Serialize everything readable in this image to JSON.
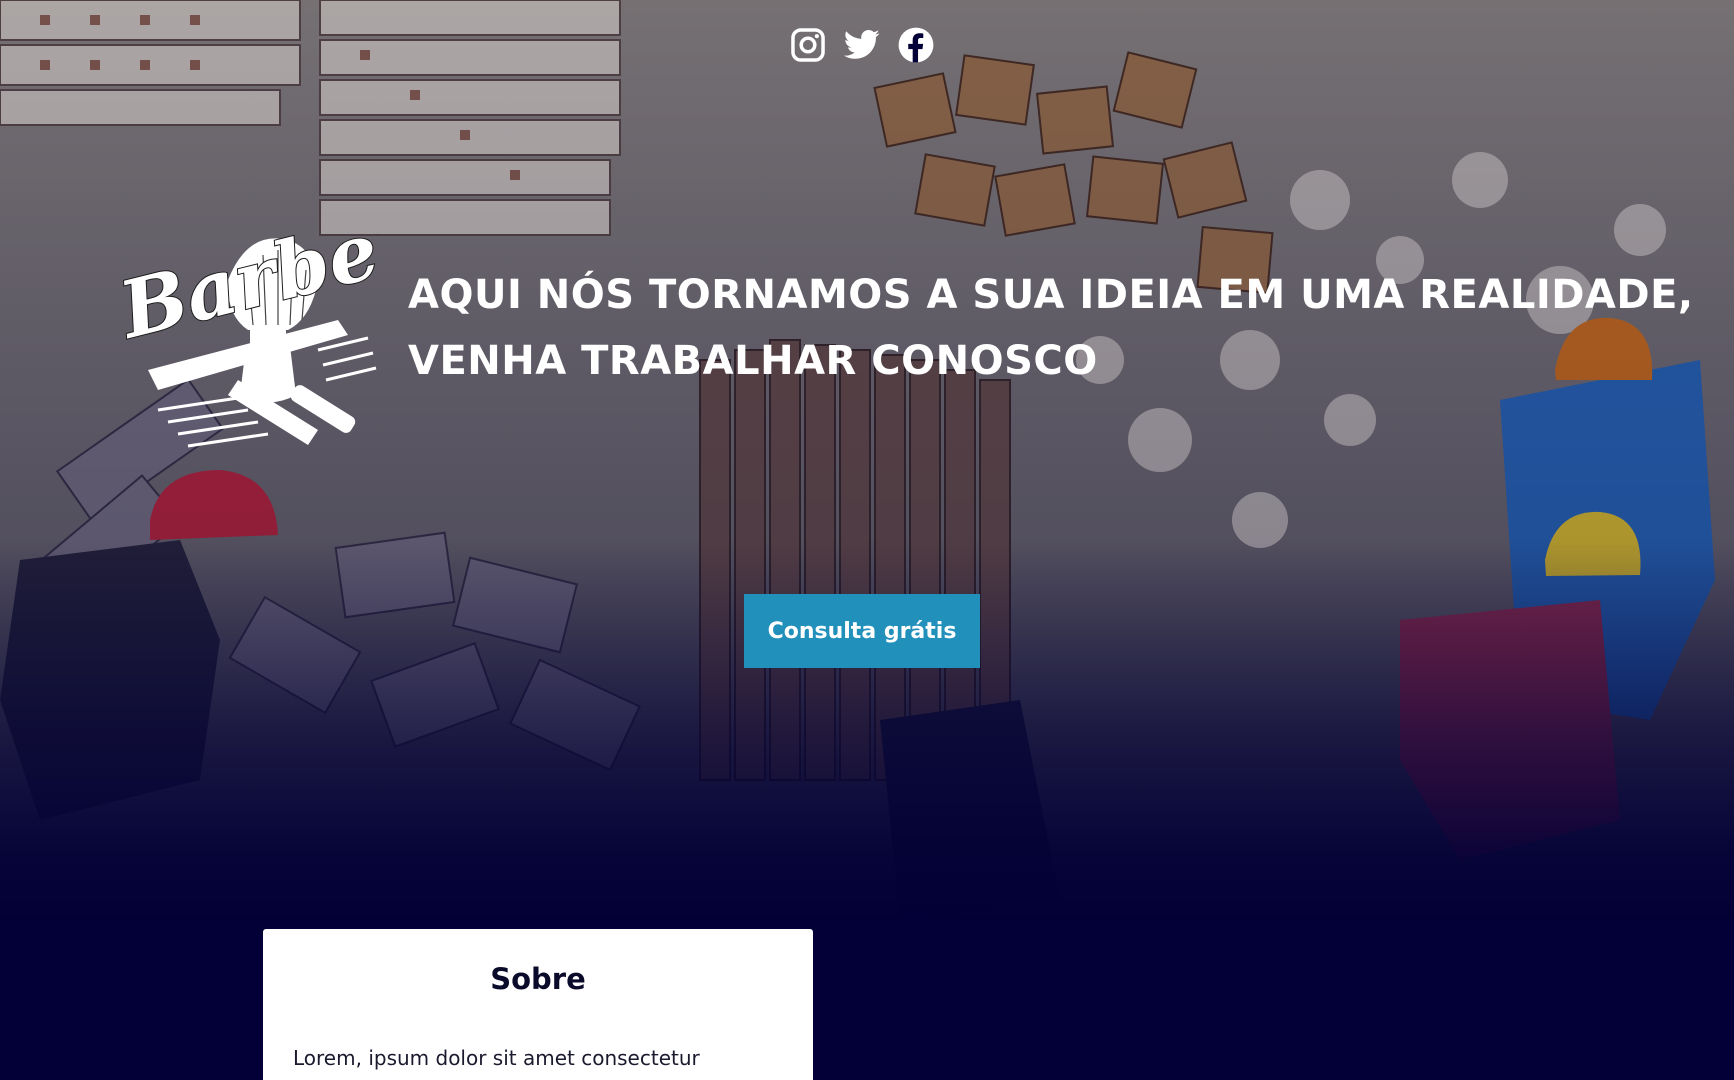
{
  "social": {
    "icons": [
      "instagram-icon",
      "twitter-icon",
      "facebook-icon"
    ]
  },
  "logo": {
    "text": "Barber"
  },
  "hero": {
    "headline_line1": "AQUI NÓS TORNAMOS A SUA IDEIA EM UMA REALIDADE,",
    "headline_line2": "VENHA TRABALHAR CONOSCO",
    "cta_label": "Consulta grátis"
  },
  "about": {
    "title": "Sobre",
    "text": "Lorem, ipsum dolor sit amet consectetur"
  },
  "colors": {
    "background": "#020036",
    "cta": "#2190bb",
    "text_light": "#ffffff",
    "card": "#ffffff"
  }
}
